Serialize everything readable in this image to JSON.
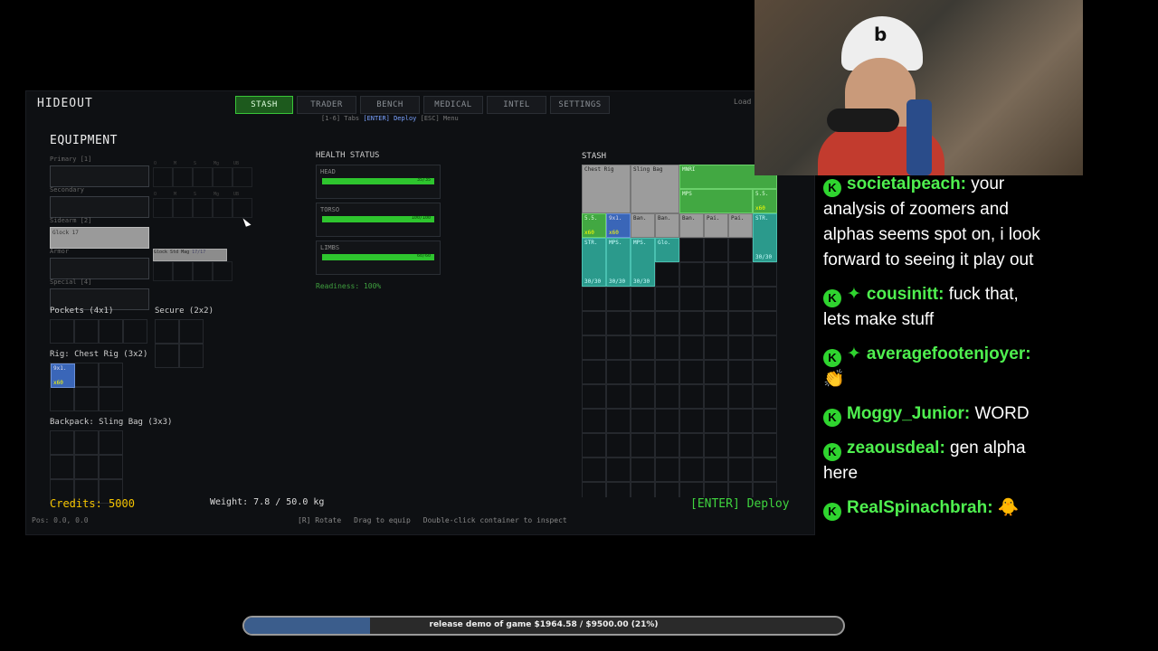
{
  "game": {
    "title": "HIDEOUT",
    "tabs": [
      "STASH",
      "TRADER",
      "BENCH",
      "MEDICAL",
      "INTEL",
      "SETTINGS"
    ],
    "active_tab": "STASH",
    "hint_parts": [
      "[1-6] Tabs",
      "[ENTER] Deploy",
      "[ESC] Menu"
    ],
    "load_label": "Load",
    "equipment": {
      "heading": "EQUIPMENT",
      "primary": "Primary [1]",
      "secondary": "Secondary",
      "sidearm": "Sidearm [2]",
      "sidearm_item": "Glock 17",
      "armor": "Armor",
      "special": "Special [4]",
      "mod_labels": [
        "O",
        "M",
        "S",
        "Mg",
        "UB"
      ],
      "mag_item": "Glock Std Mag",
      "mag_count": "17/17",
      "pockets": "Pockets (4x1)",
      "secure": "Secure (2x2)",
      "rig": "Rig: Chest Rig (3x2)",
      "rig_item": "9x1.",
      "rig_item_qty": "x60",
      "backpack": "Backpack: Sling Bag (3x3)"
    },
    "health": {
      "heading": "HEALTH STATUS",
      "parts": [
        {
          "name": "HEAD",
          "value": "35/35",
          "level": 1.0
        },
        {
          "name": "TORSO",
          "value": "100/100",
          "level": 1.0
        },
        {
          "name": "LIMBS",
          "value": "60/60",
          "level": 1.0
        }
      ],
      "readiness": "Readiness: 100%"
    },
    "stash": {
      "heading": "STASH",
      "items": [
        {
          "label": "Chest Rig",
          "color": "gray",
          "q": ""
        },
        {
          "label": "Sling Bag",
          "color": "gray",
          "q": ""
        },
        {
          "label": "MNRI",
          "color": "green",
          "q": ""
        },
        {
          "label": "MPS",
          "color": "green",
          "q": ""
        },
        {
          "label": "5.5.",
          "color": "green",
          "q": "x60"
        },
        {
          "label": "5.5.",
          "color": "green",
          "q": "x60"
        },
        {
          "label": "9x1.",
          "color": "blue",
          "q": "x60"
        },
        {
          "label": "Ban.",
          "color": "gray",
          "q": ""
        },
        {
          "label": "Ban.",
          "color": "gray",
          "q": ""
        },
        {
          "label": "Ban.",
          "color": "gray",
          "q": ""
        },
        {
          "label": "Pai.",
          "color": "gray",
          "q": ""
        },
        {
          "label": "Pai.",
          "color": "gray",
          "q": ""
        },
        {
          "label": "STR.",
          "color": "teal",
          "q": "30/30"
        },
        {
          "label": "STR.",
          "color": "teal",
          "q": "30/30"
        },
        {
          "label": "MPS.",
          "color": "teal",
          "q": "30/30"
        },
        {
          "label": "MPS.",
          "color": "teal",
          "q": "30/30"
        },
        {
          "label": "Glo.",
          "color": "teal",
          "q": ""
        }
      ]
    },
    "credits": "Credits: 5000",
    "weight": "Weight: 7.8 / 50.0 kg",
    "deploy": "[ENTER] Deploy",
    "pos": "Pos: 0.0, 0.0",
    "footer": [
      "[R] Rotate",
      "Drag to equip",
      "Double-click container to inspect"
    ]
  },
  "webcam": {
    "cap_logo": "b"
  },
  "chat": [
    {
      "user": "societalpeach",
      "sub": false,
      "text": "your analysis of zoomers and alphas seems spot on, i look forward to seeing it play out"
    },
    {
      "user": "cousinitt",
      "sub": true,
      "text": "fuck that, lets make stuff"
    },
    {
      "user": "averagefootenjoyer",
      "sub": true,
      "text": "👏"
    },
    {
      "user": "Moggy_Junior",
      "sub": false,
      "text": "WORD"
    },
    {
      "user": "zeaousdeal",
      "sub": false,
      "text": "gen alpha here"
    },
    {
      "user": "RealSpinachbrah",
      "sub": false,
      "text": "🐥"
    }
  ],
  "goal": {
    "text": "release demo of game $1964.58 / $9500.00 (21%)",
    "progress": 0.21
  },
  "colors": {
    "accent_green": "#2fd42f",
    "credits": "#f5c400",
    "tab_active": "#1d5a1d"
  },
  "icons": {
    "chat_badge": "kick-icon",
    "sub_badge": "sub-diamond-icon",
    "cursor": "mouse-cursor-icon"
  }
}
